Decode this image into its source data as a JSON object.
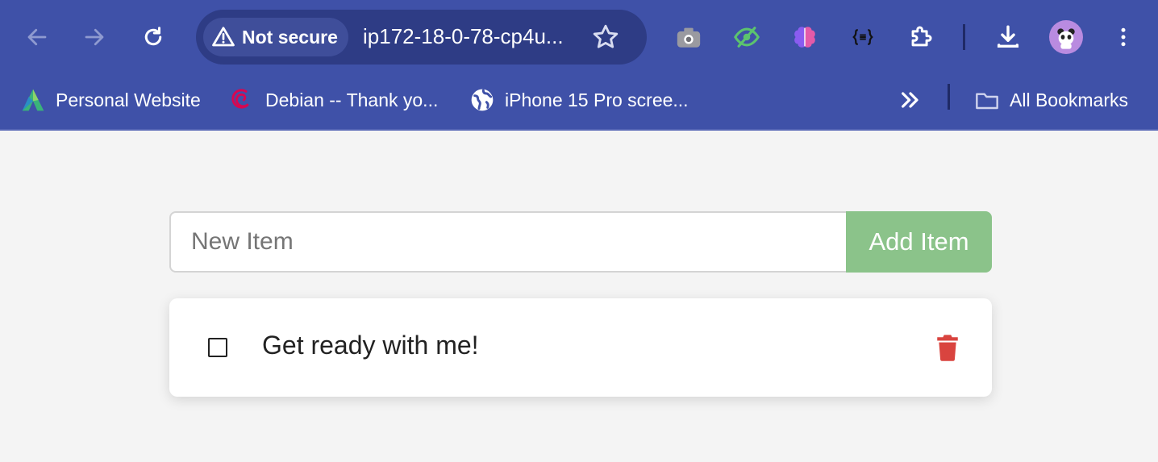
{
  "browser": {
    "security_label": "Not secure",
    "url": "ip172-18-0-78-cp4u...",
    "accent": "#3f51a8",
    "bookmarks": [
      {
        "label": "Personal Website",
        "icon": "personal-website-logo-icon"
      },
      {
        "label": "Debian -- Thank yo...",
        "icon": "debian-swirl-icon"
      },
      {
        "label": "iPhone 15 Pro scree...",
        "icon": "globe-icon"
      }
    ],
    "all_bookmarks_label": "All Bookmarks"
  },
  "todo": {
    "input_placeholder": "New Item",
    "input_value": "",
    "add_button_label": "Add Item",
    "add_button_color": "#8bc38a",
    "items": [
      {
        "text": "Get ready with me!",
        "done": false
      }
    ],
    "delete_color": "#d9443f"
  }
}
